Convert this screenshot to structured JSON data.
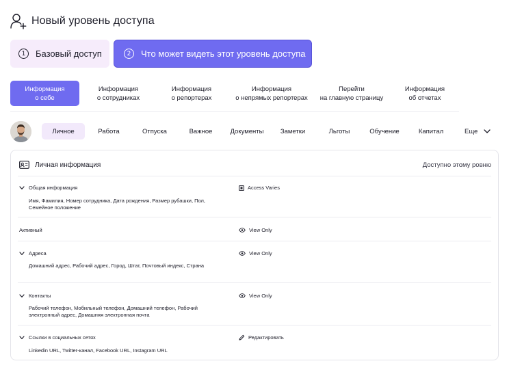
{
  "header": {
    "title": "Новый уровень доступа",
    "icon": "add-user-icon"
  },
  "steps": [
    {
      "number": "1",
      "label": "Базовый доступ"
    },
    {
      "number": "2",
      "label": "Что может видеть этот уровень доступа"
    }
  ],
  "tabs": [
    {
      "line1": "Информация",
      "line2": "о себе"
    },
    {
      "line1": "Информация",
      "line2": "о сотрудниках"
    },
    {
      "line1": "Информация",
      "line2": "о репортерах"
    },
    {
      "line1": "Информация",
      "line2": "о непрямых репортерах"
    },
    {
      "line1": "Перейти",
      "line2": "на главную страницу"
    },
    {
      "line1": "Информация",
      "line2": "об отчетах"
    }
  ],
  "subnav": {
    "items": [
      "Личное",
      "Работа",
      "Отпуска",
      "Важное",
      "Документы",
      "Заметки",
      "Льготы",
      "Обучение",
      "Капитал"
    ],
    "more": "Еще"
  },
  "card": {
    "title": "Личная информация",
    "right_label": "Доступно этому ровню",
    "rows": [
      {
        "title": "Общая информация",
        "description": "Имя, Фамилия, Номер сотрудника, Дата рождения, Размер рубашки, Пол, Семейное положение",
        "access": "Access Varies",
        "access_icon": "square-icon",
        "expandable": true
      },
      {
        "title": "Активный",
        "description": "",
        "access": "View Only",
        "access_icon": "eye-icon",
        "expandable": false
      },
      {
        "title": "Адреса",
        "description": "Домашний адрес, Рабочий адрес, Город, Штат, Почтовый индекс, Страна",
        "access": "View Only",
        "access_icon": "eye-icon",
        "expandable": true
      },
      {
        "title": "Контакты",
        "description": "Рабочий телефон, Мобильный телефон, Домашний телефон, Рабочий электронный адрес, Домашняя электронная почта",
        "access": "View Only",
        "access_icon": "eye-icon",
        "expandable": true
      },
      {
        "title": "Ссылки в социальных сетях",
        "description": "Linkedin URL, Twitter-канал, Facebook URL, Instagram URL",
        "access": "Редактировать",
        "access_icon": "pencil-icon",
        "expandable": true
      }
    ]
  },
  "colors": {
    "accent": "#6f6bf0",
    "accent_soft": "#f6ecfb"
  }
}
